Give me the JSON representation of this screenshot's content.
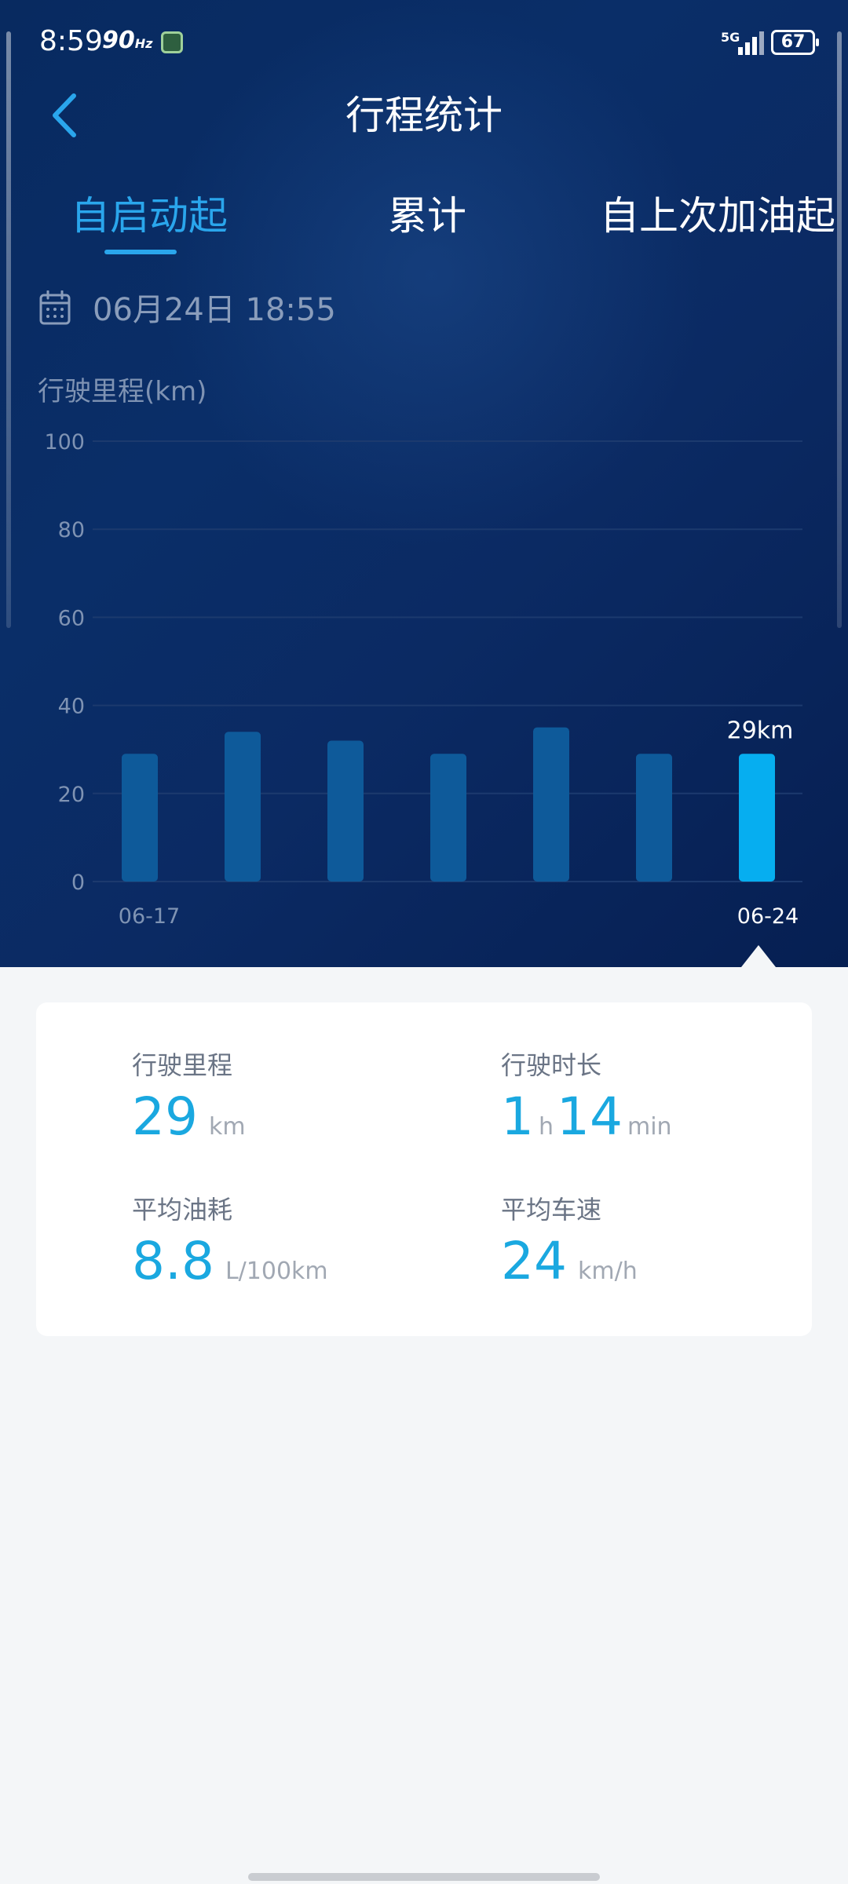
{
  "status_bar": {
    "time": "8:59",
    "refresh_rate": "90",
    "refresh_unit": "Hz",
    "network": "5G",
    "battery": "67"
  },
  "header": {
    "title": "行程统计"
  },
  "tabs": [
    {
      "label": "自启动起",
      "active": true
    },
    {
      "label": "累计",
      "active": false
    },
    {
      "label": "自上次加油起",
      "active": false
    }
  ],
  "date": {
    "text": "06月24日 18:55"
  },
  "chart_data": {
    "type": "bar",
    "ylabel": "行驶里程(km)",
    "ylim": [
      0,
      100
    ],
    "yticks": [
      0,
      20,
      40,
      60,
      80,
      100
    ],
    "categories": [
      "06-17",
      "",
      "",
      "",
      "",
      "",
      "06-24"
    ],
    "values": [
      29,
      34,
      32,
      29,
      35,
      29,
      29
    ],
    "highlight_index": 6,
    "highlight_label": "29km",
    "grid": true,
    "colors": {
      "bar": "#0e5a9a",
      "highlight": "#06aef0",
      "grid": "#1c3a6e",
      "tick": "#7f93b3"
    }
  },
  "summary": {
    "distance": {
      "label": "行驶里程",
      "value": "29",
      "unit": "km"
    },
    "duration": {
      "label": "行驶时长",
      "hours": "1",
      "hours_unit": "h",
      "minutes": "14",
      "minutes_unit": "min"
    },
    "fuel": {
      "label": "平均油耗",
      "value": "8.8",
      "unit": "L/100km"
    },
    "speed": {
      "label": "平均车速",
      "value": "24",
      "unit": "km/h"
    }
  }
}
